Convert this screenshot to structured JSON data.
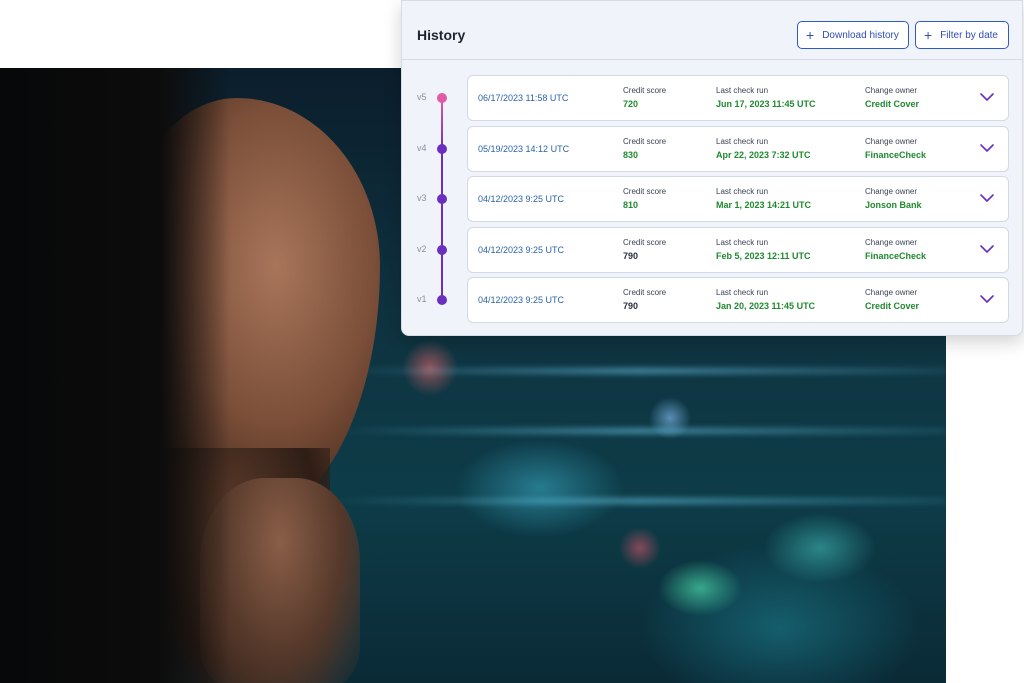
{
  "panel": {
    "title": "History",
    "buttons": {
      "download": "Download history",
      "filter": "Filter by date"
    }
  },
  "labels": {
    "credit_score": "Credit score",
    "last_check_run": "Last check run",
    "change_owner": "Change owner"
  },
  "versions": [
    {
      "version": "v5",
      "date": "06/17/2023 11:58 UTC",
      "credit_score": "720",
      "last_check": "Jun 17, 2023 11:45 UTC",
      "owner": "Credit Cover",
      "score_color": "green"
    },
    {
      "version": "v4",
      "date": "05/19/2023 14:12 UTC",
      "credit_score": "830",
      "last_check": "Apr 22, 2023 7:32 UTC",
      "owner": "FinanceCheck",
      "score_color": "green"
    },
    {
      "version": "v3",
      "date": "04/12/2023 9:25 UTC",
      "credit_score": "810",
      "last_check": "Mar 1, 2023 14:21 UTC",
      "owner": "Jonson Bank",
      "score_color": "green"
    },
    {
      "version": "v2",
      "date": "04/12/2023 9:25 UTC",
      "credit_score": "790",
      "last_check": "Feb 5, 2023 12:11 UTC",
      "owner": "FinanceCheck",
      "score_color": "dark"
    },
    {
      "version": "v1",
      "date": "04/12/2023 9:25 UTC",
      "credit_score": "790",
      "last_check": "Jan 20, 2023 11:45 UTC",
      "owner": "Credit Cover",
      "score_color": "dark"
    }
  ],
  "colors": {
    "accent": "#2f5bc7",
    "timeline_latest": "#e05aa8",
    "timeline": "#6a2fc0",
    "positive": "#1f8a2e"
  }
}
